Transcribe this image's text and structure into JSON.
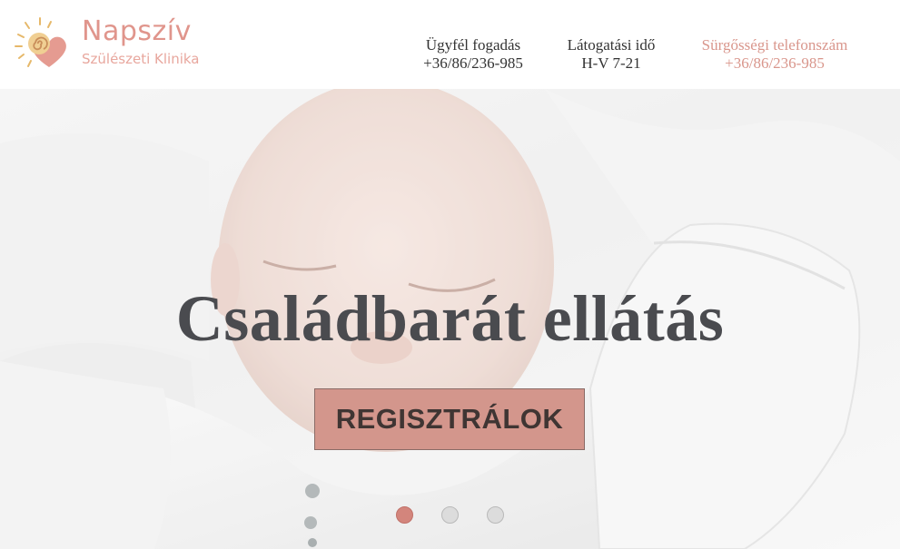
{
  "header": {
    "brand_name": "Napszív",
    "brand_sub": "Szülészeti Klinika",
    "info": [
      {
        "label": "Ügyfél fogadás",
        "value": "+36/86/236-985"
      },
      {
        "label": "Látogatási idő",
        "value": "H-V 7-21"
      },
      {
        "label": "Sürgősségi telefonszám",
        "value": "+36/86/236-985"
      }
    ]
  },
  "hero": {
    "headline": "Családbarát ellátás",
    "cta_label": "REGISZTRÁLOK",
    "slides_total": 3,
    "active_slide": 1
  },
  "colors": {
    "accent": "#d3968c",
    "brand_text": "#e0958c",
    "headline": "#4a4b4f",
    "dot_active": "#d3857c"
  }
}
